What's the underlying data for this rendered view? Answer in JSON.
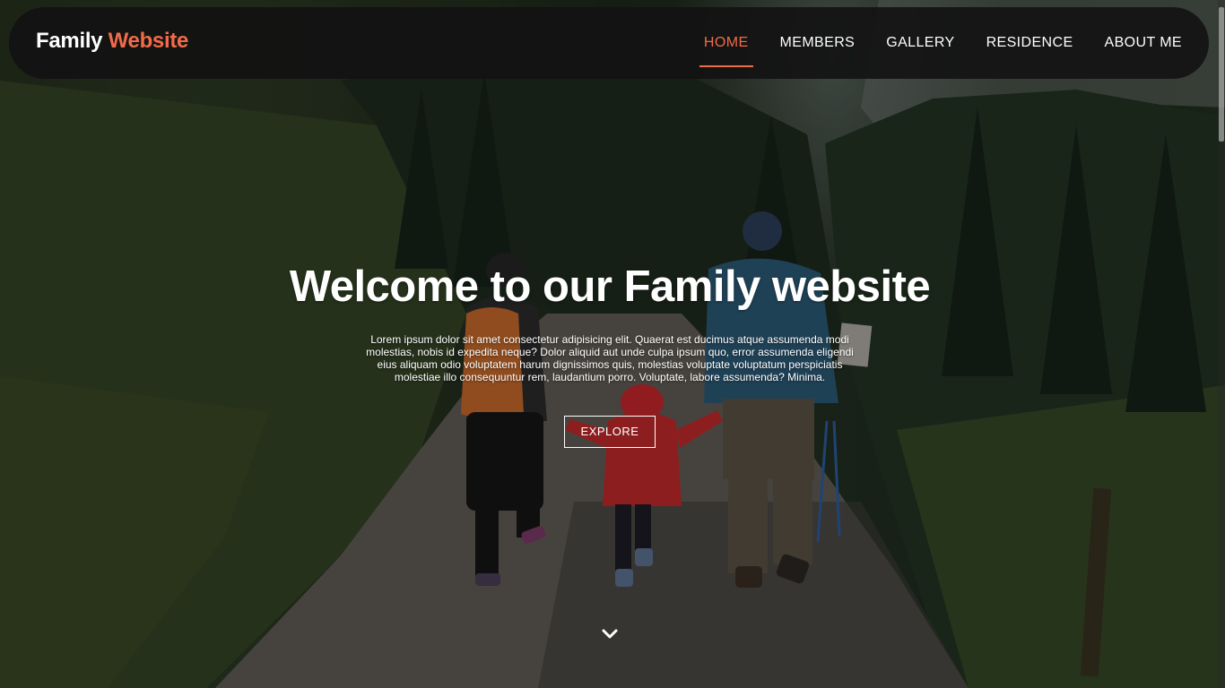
{
  "brand": {
    "name_part1": "Family",
    "name_part2": "Website",
    "accent_color": "#f26b49"
  },
  "nav": {
    "items": [
      {
        "label": "HOME",
        "active": true
      },
      {
        "label": "MEMBERS",
        "active": false
      },
      {
        "label": "GALLERY",
        "active": false
      },
      {
        "label": "RESIDENCE",
        "active": false
      },
      {
        "label": "ABOUT ME",
        "active": false
      }
    ]
  },
  "hero": {
    "title": "Welcome to our Family website",
    "lead": "Lorem ipsum dolor sit amet consectetur adipisicing elit. Quaerat est ducimus atque assumenda modi molestias, nobis id expedita neque? Dolor aliquid aut unde culpa ipsum quo, error assumenda eligendi eius aliquam odio voluptatem harum dignissimos quis, molestias voluptate voluptatum perspiciatis molestiae illo consequuntur rem, laudantium porro. Voluptate, labore assumenda? Minima.",
    "cta_label": "EXPLORE",
    "scroll_icon": "chevron-down-icon",
    "background_description_icon": "family-hiking-photo"
  }
}
